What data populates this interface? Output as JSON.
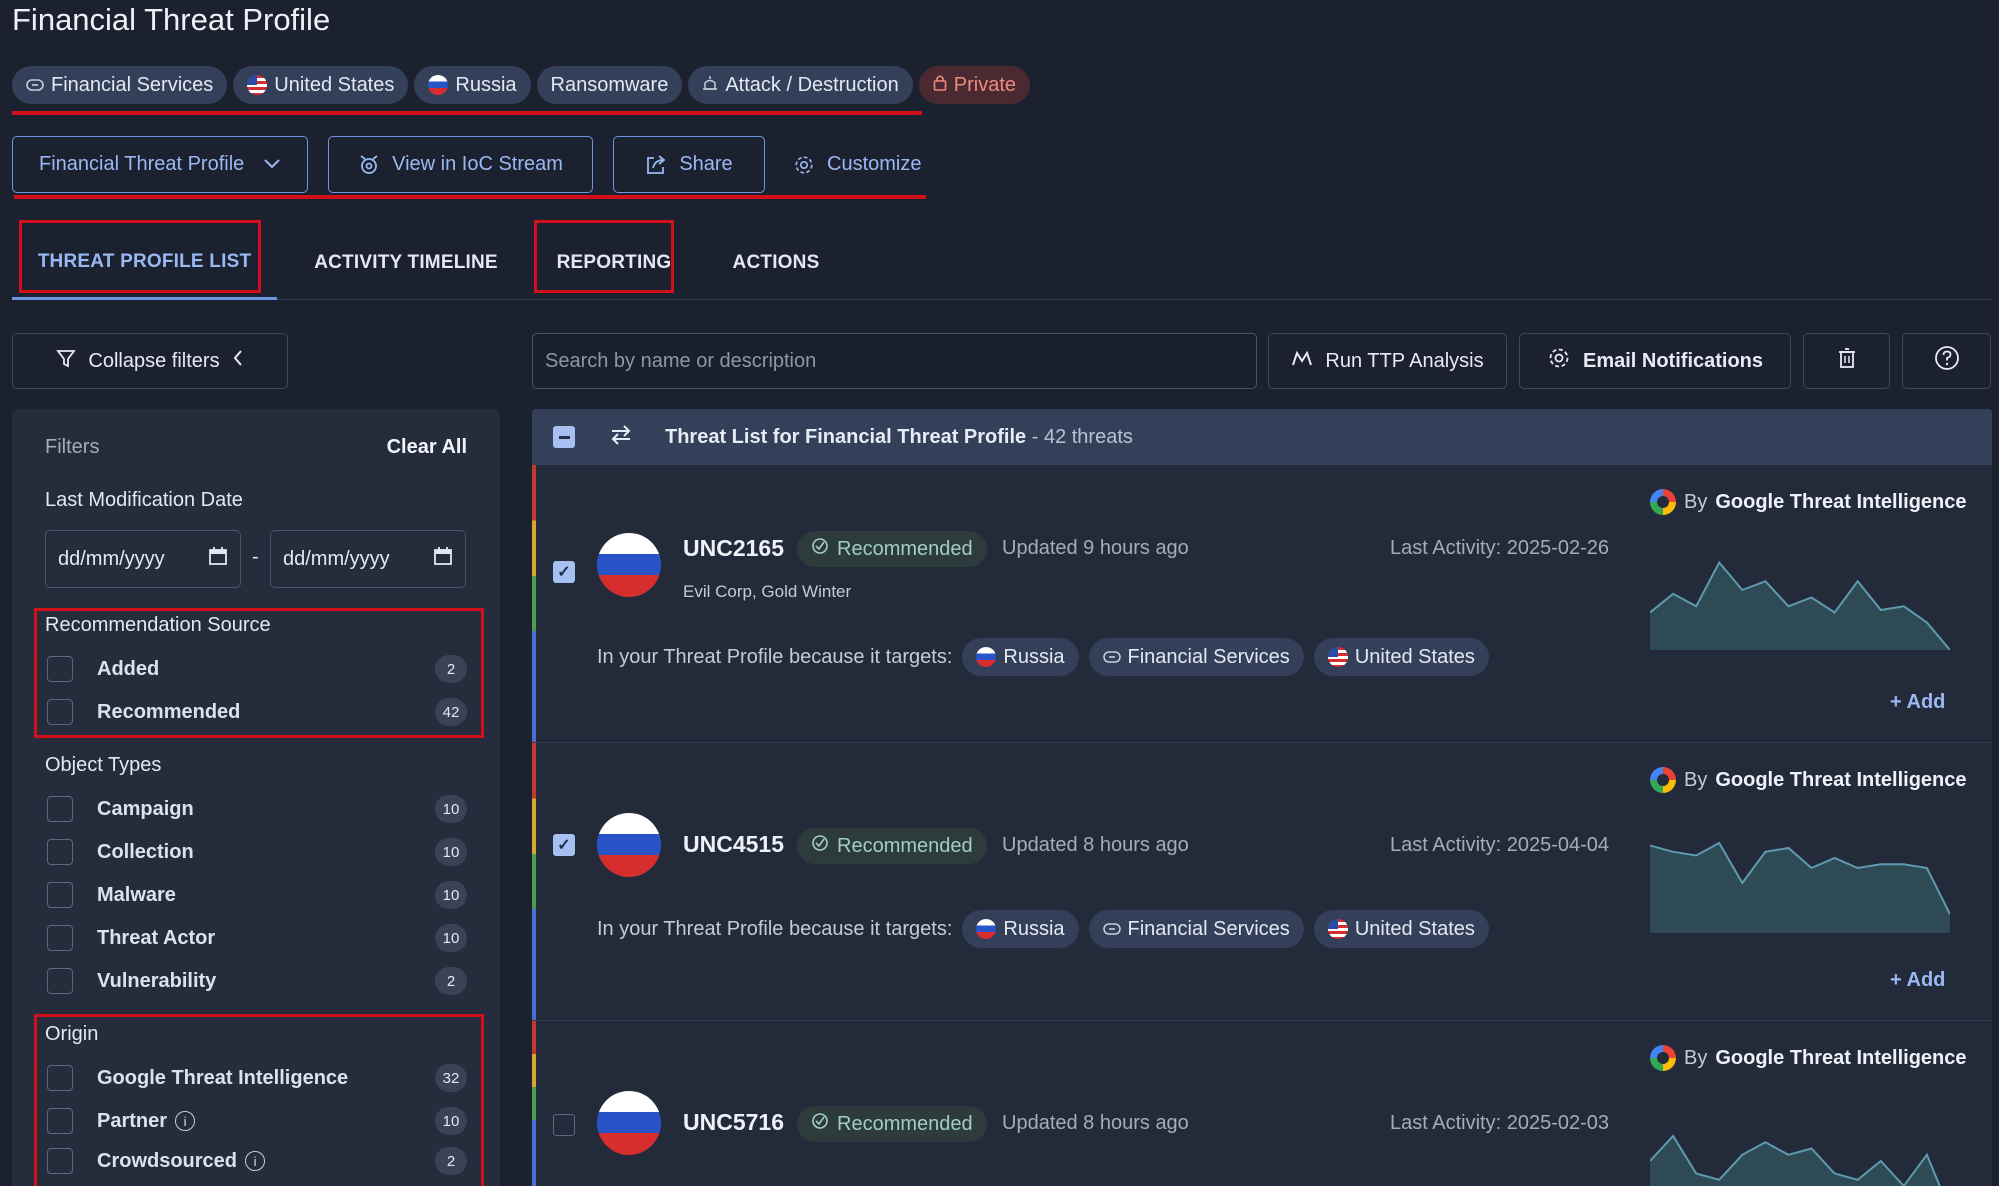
{
  "page": {
    "title": "Financial Threat Profile"
  },
  "tags": [
    {
      "label": "Financial Services",
      "icon": "link-icon"
    },
    {
      "label": "United States",
      "icon": "us-flag-icon"
    },
    {
      "label": "Russia",
      "icon": "russia-flag-icon"
    },
    {
      "label": "Ransomware",
      "icon": ""
    },
    {
      "label": "Attack / Destruction",
      "icon": "bomb-icon"
    },
    {
      "label": "Private",
      "icon": "lock-icon"
    }
  ],
  "actions": {
    "profile_select": "Financial Threat Profile",
    "view_ioc": "View in IoC Stream",
    "share": "Share",
    "customize": "Customize"
  },
  "tabs": [
    "THREAT PROFILE LIST",
    "ACTIVITY TIMELINE",
    "REPORTING",
    "ACTIONS"
  ],
  "toolbar": {
    "collapse_filters": "Collapse filters",
    "search_placeholder": "Search by name or description",
    "run_ttp": "Run TTP Analysis",
    "email_notifications": "Email Notifications"
  },
  "filters": {
    "title": "Filters",
    "clear_all": "Clear All",
    "date_label": "Last Modification Date",
    "date_from": "dd/mm/yyyy",
    "date_sep": "-",
    "date_to": "dd/mm/yyyy",
    "rec_source": {
      "label": "Recommendation Source",
      "items": [
        {
          "label": "Added",
          "count": "2"
        },
        {
          "label": "Recommended",
          "count": "42"
        }
      ]
    },
    "object_types": {
      "label": "Object Types",
      "items": [
        {
          "label": "Campaign",
          "count": "10"
        },
        {
          "label": "Collection",
          "count": "10"
        },
        {
          "label": "Malware",
          "count": "10"
        },
        {
          "label": "Threat Actor",
          "count": "10"
        },
        {
          "label": "Vulnerability",
          "count": "2"
        }
      ]
    },
    "origin": {
      "label": "Origin",
      "items": [
        {
          "label": "Google Threat Intelligence",
          "count": "32"
        },
        {
          "label": "Partner",
          "count": "10"
        },
        {
          "label": "Crowdsourced",
          "count": "2"
        }
      ]
    }
  },
  "list": {
    "title": "Threat List for Financial Threat Profile",
    "count": "- 42 threats",
    "because_label": "In your Threat Profile because it targets:",
    "by_label": "By",
    "by_source": "Google Threat Intelligence",
    "add_label": "Add",
    "rec_label": "Recommended",
    "cards": [
      {
        "name": "UNC2165",
        "updated": "Updated 9 hours ago",
        "last": "Last Activity: 2025-02-26",
        "aliases": "Evil Corp, Gold Winter",
        "checked": true,
        "targets": [
          "Russia",
          "Financial Services",
          "United States"
        ],
        "spark": [
          30,
          45,
          35,
          70,
          48,
          55,
          35,
          42,
          30,
          55,
          32,
          35,
          22,
          0
        ]
      },
      {
        "name": "UNC4515",
        "updated": "Updated 8 hours ago",
        "last": "Last Activity: 2025-04-04",
        "aliases": "",
        "checked": true,
        "targets": [
          "Russia",
          "Financial Services",
          "United States"
        ],
        "spark": [
          70,
          65,
          62,
          72,
          40,
          65,
          68,
          52,
          60,
          52,
          55,
          55,
          52,
          15
        ]
      },
      {
        "name": "UNC5716",
        "updated": "Updated 8 hours ago",
        "last": "Last Activity: 2025-02-03",
        "aliases": "",
        "checked": false,
        "targets": [],
        "spark": [
          40,
          60,
          30,
          25,
          45,
          55,
          45,
          50,
          30,
          25,
          40,
          20,
          45,
          0
        ]
      }
    ]
  },
  "colors": {
    "accent": "#6f95e0",
    "highlight": "#d2101c",
    "panel": "#252c3c",
    "background": "#1c2130"
  }
}
